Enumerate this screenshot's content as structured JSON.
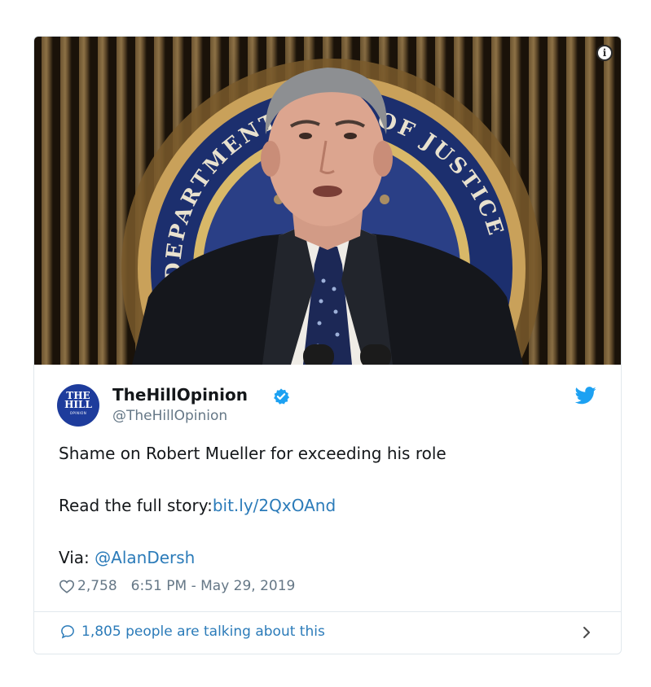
{
  "media": {
    "info_icon": "i",
    "seal_text_left": "DEPARTMENT",
    "seal_text_right": "OF JUSTICE"
  },
  "author": {
    "avatar_line1": "THE",
    "avatar_line2": "HILL",
    "avatar_line3": "OPINION",
    "display_name": "TheHillOpinion",
    "handle": "@TheHillOpinion",
    "verified": true
  },
  "tweet": {
    "line1": "Shame on Robert Mueller for exceeding his role",
    "line2_prefix": "Read the full story:",
    "line2_link": "bit.ly/2QxOAnd",
    "line3_prefix": "Via: ",
    "line3_mention": "@AlanDersh"
  },
  "stats": {
    "likes": "2,758",
    "timestamp": "6:51 PM - May 29, 2019"
  },
  "footer": {
    "talking_text": "1,805 people are talking about this"
  },
  "colors": {
    "link": "#2b7bb9",
    "twitter_blue": "#1da1f2",
    "muted": "#657786",
    "border": "#e1e8ed"
  }
}
